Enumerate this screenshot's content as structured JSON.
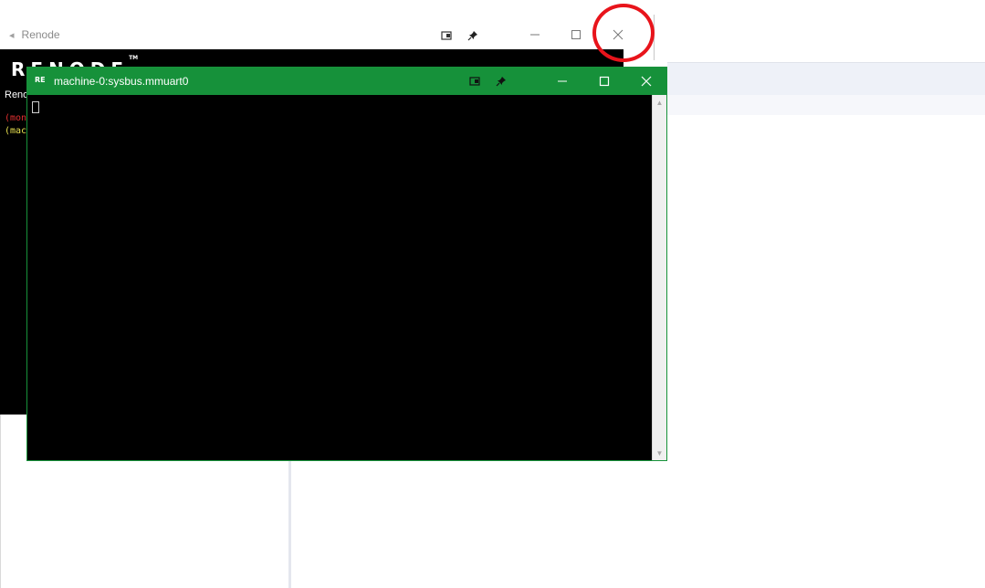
{
  "background_window": {
    "title": "Renode",
    "logo_text": "RENODE",
    "logo_mark": "TM",
    "renode_line": "Reno",
    "monitor_prompt": "(mon",
    "machine_prompt": "(mac"
  },
  "uart_window": {
    "title": "machine-0:sysbus.mmuart0",
    "icon_text": "RE"
  },
  "icons": {
    "popout": "popout-icon",
    "pin": "pin-icon",
    "minimize": "minimize-icon",
    "maximize": "maximize-icon",
    "close": "close-icon"
  },
  "colors": {
    "uart_titlebar": "#16913a",
    "annotation": "#e8141b",
    "monitor_prompt": "#e03030",
    "machine_prompt": "#e8e050"
  }
}
